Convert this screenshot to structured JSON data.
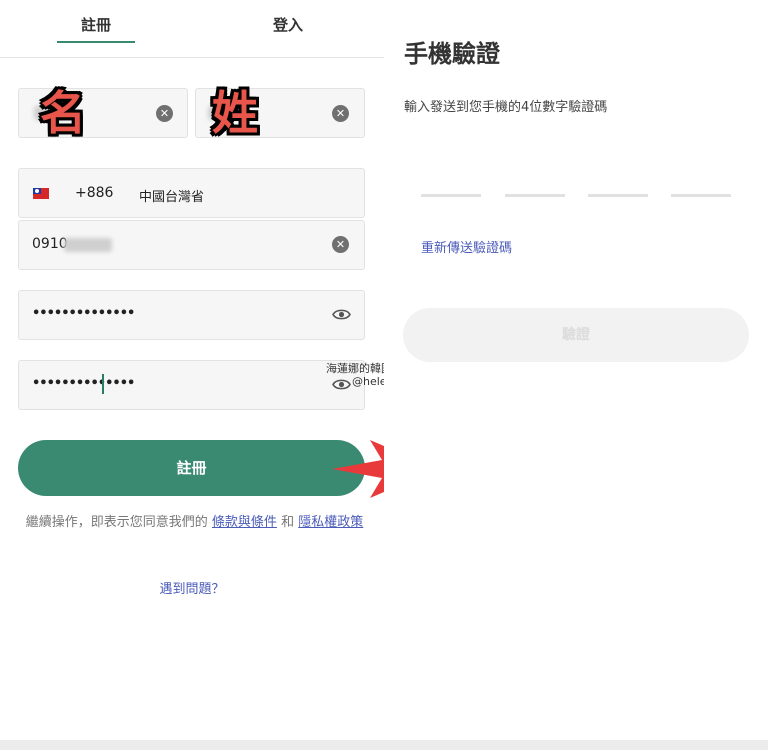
{
  "register": {
    "tabs": {
      "register": "註冊",
      "login": "登入"
    },
    "annotations": {
      "first_name": "名",
      "last_name": "姓"
    },
    "phone": {
      "country_code": "+886",
      "region": "中國台灣省",
      "number_visible": "0910"
    },
    "password": {
      "value_mask": "••••••••••••••",
      "confirm_mask": "••••••••••••••"
    },
    "submit_label": "註冊",
    "terms": {
      "prefix": "繼續操作，即表示您同意我們的",
      "terms_link": "條款與條件",
      "and": "和",
      "privacy_link": "隱私權政策"
    },
    "help_link": "遇到問題？"
  },
  "watermark": {
    "line1": "海蓮娜的韓國大世界",
    "line2": "@helena.tw"
  },
  "verify": {
    "title": "手機驗證",
    "description": "輸入發送到您手機的4位數字驗證碼",
    "resend_link": "重新傳送驗證碼",
    "submit_label": "驗證"
  },
  "colors": {
    "accent": "#3a8a72",
    "link": "#4b5bb8",
    "arrow": "#e83a3a",
    "annotation": "#e8554a"
  }
}
